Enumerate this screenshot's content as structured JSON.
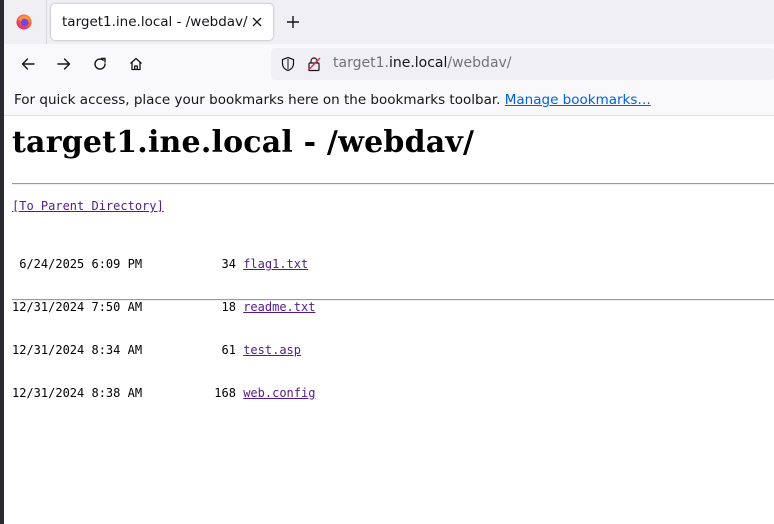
{
  "browser": {
    "tab_title": "target1.ine.local - /webdav/",
    "url_prefix": "target1.",
    "url_host": "ine.local",
    "url_path": "/webdav/",
    "bookmarks_message": "For quick access, place your bookmarks here on the bookmarks toolbar.",
    "manage_bookmarks_label": "Manage bookmarks…"
  },
  "page": {
    "title": "target1.ine.local - /webdav/",
    "parent_link": "[To Parent Directory]",
    "files": [
      {
        "date": " 6/24/2025",
        "time": " 6:09 PM",
        "size": "34",
        "name": "flag1.txt"
      },
      {
        "date": "12/31/2024",
        "time": " 7:50 AM",
        "size": "18",
        "name": "readme.txt"
      },
      {
        "date": "12/31/2024",
        "time": " 8:34 AM",
        "size": "61",
        "name": "test.asp"
      },
      {
        "date": "12/31/2024",
        "time": " 8:38 AM",
        "size": "168",
        "name": "web.config"
      }
    ]
  },
  "colors": {
    "link": "#0061e0",
    "visited_link": "#551a8b",
    "toolbar_bg": "#f9f9fb",
    "tabstrip_bg": "#f0f0f4"
  }
}
